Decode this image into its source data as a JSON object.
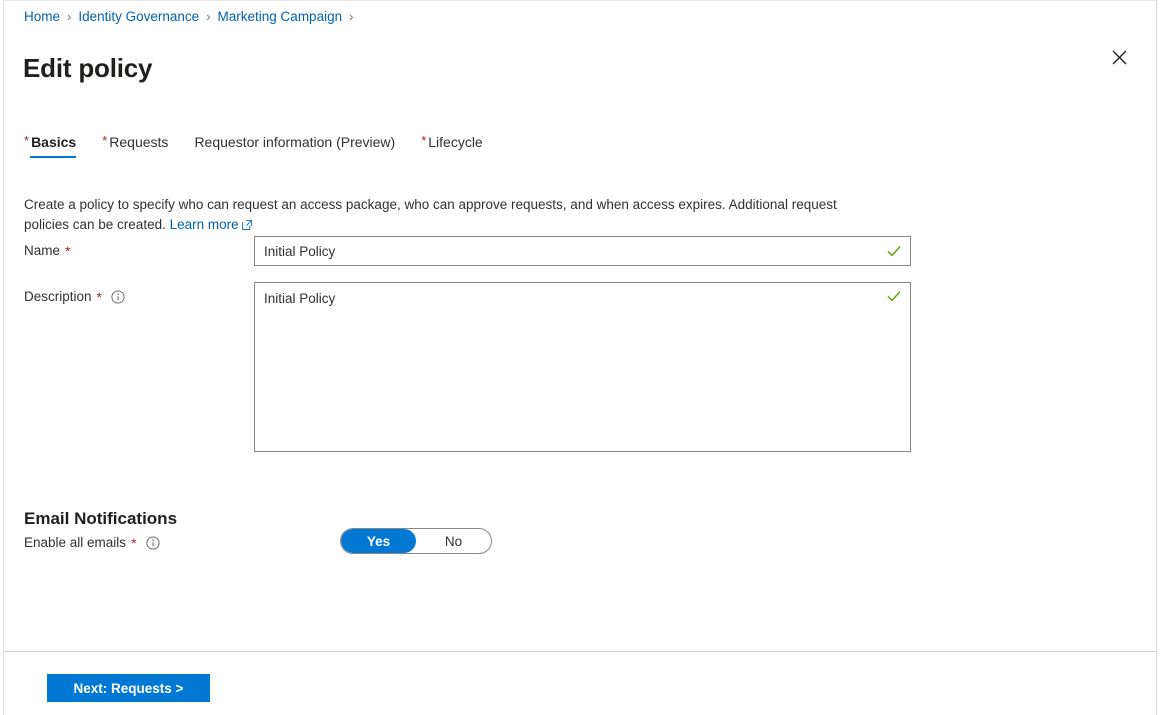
{
  "breadcrumb": {
    "separator": "›",
    "items": [
      {
        "label": "Home"
      },
      {
        "label": "Identity Governance"
      },
      {
        "label": "Marketing Campaign"
      }
    ]
  },
  "header": {
    "title": "Edit policy",
    "close_icon": "close-icon"
  },
  "tabs": [
    {
      "label": "Basics",
      "required": true,
      "active": true
    },
    {
      "label": "Requests",
      "required": true,
      "active": false
    },
    {
      "label": "Requestor information (Preview)",
      "required": false,
      "active": false
    },
    {
      "label": "Lifecycle",
      "required": true,
      "active": false
    }
  ],
  "intro": {
    "text": "Create a policy to specify who can request an access package, who can approve requests, and when access expires. Additional request policies can be created.",
    "link_text": "Learn more",
    "link_icon": "external-link-icon"
  },
  "form": {
    "required_marker": "*",
    "name": {
      "label": "Name",
      "value": "Initial Policy",
      "placeholder": "",
      "valid": true,
      "valid_icon": "checkmark-icon"
    },
    "description": {
      "label": "Description",
      "value": "Initial Policy",
      "placeholder": "",
      "valid": true,
      "valid_icon": "checkmark-icon",
      "info_icon": "info-icon"
    }
  },
  "email_notifications": {
    "heading": "Email Notifications",
    "enable_all": {
      "label": "Enable all emails",
      "info_icon": "info-icon",
      "options": [
        {
          "label": "Yes",
          "selected": true
        },
        {
          "label": "No",
          "selected": false
        }
      ]
    }
  },
  "footer": {
    "next_button": "Next: Requests >"
  },
  "colors": {
    "accent": "#0078d4",
    "link": "#0063b1",
    "required_star": "#a4262c",
    "valid_green": "#57a300",
    "text": "#323130",
    "border": "#8a8886"
  }
}
